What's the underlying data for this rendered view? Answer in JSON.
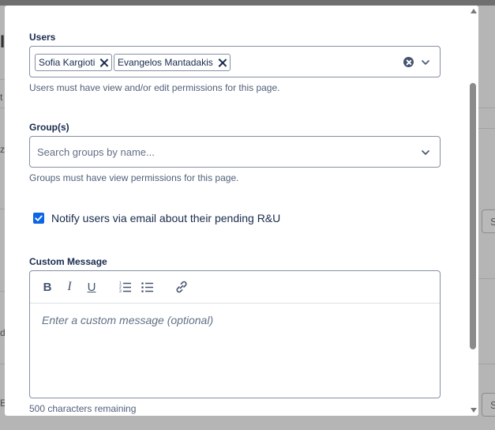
{
  "background": {
    "left_fragments": [
      "I",
      "t",
      "zU",
      "d",
      "E"
    ],
    "right_button_label": "S"
  },
  "users": {
    "label": "Users",
    "selected": [
      {
        "name": "Sofia Kargioti"
      },
      {
        "name": "Evangelos Mantadakis"
      }
    ],
    "help": "Users must have view and/or edit permissions for this page."
  },
  "groups": {
    "label": "Group(s)",
    "placeholder": "Search groups by name...",
    "help": "Groups must have view permissions for this page."
  },
  "notify": {
    "checked": true,
    "label": "Notify users via email about their pending R&U"
  },
  "custom_message": {
    "label": "Custom Message",
    "toolbar": {
      "bold": "B",
      "italic": "I",
      "underline": "U"
    },
    "placeholder": "Enter a custom message (optional)",
    "remaining": "500 characters remaining"
  },
  "icons": {
    "chip_remove": "close-icon",
    "clear": "clear-circle-icon",
    "dropdown": "chevron-down-icon",
    "ordered_list": "numbered-list-icon",
    "bullet_list": "bullet-list-icon",
    "link": "link-icon"
  },
  "colors": {
    "accent": "#0c66e4",
    "text": "#172b4d",
    "subtle": "#505f79",
    "border": "#8590a2"
  }
}
